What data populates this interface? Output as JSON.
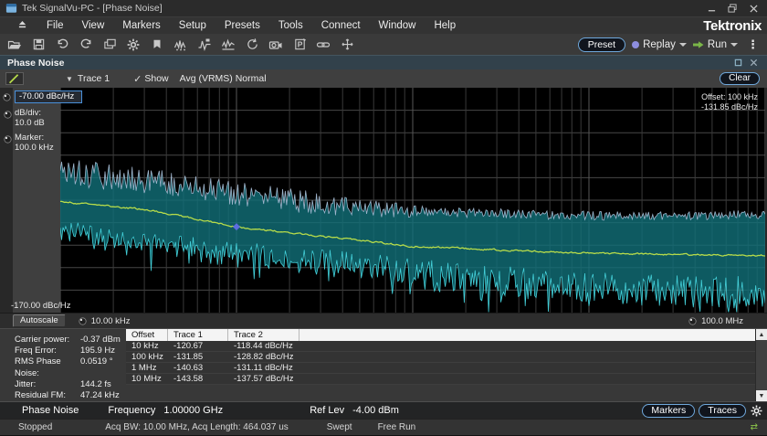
{
  "window": {
    "title": "Tek SignalVu-PC - [Phase Noise]",
    "brand": "Tektronix"
  },
  "menu": {
    "items": [
      "File",
      "View",
      "Markers",
      "Setup",
      "Presets",
      "Tools",
      "Connect",
      "Window",
      "Help"
    ]
  },
  "toolbar": {
    "preset": "Preset",
    "replay": "Replay",
    "run": "Run",
    "icons": [
      "open",
      "save",
      "undo",
      "redo",
      "displays",
      "settings",
      "marker-banner",
      "spurious",
      "pulse-marker",
      "spectrum",
      "loop",
      "camera",
      "paste-p",
      "link",
      "expand"
    ]
  },
  "panel": {
    "title": "Phase Noise",
    "clear": "Clear"
  },
  "trace_bar": {
    "trace": "Trace 1",
    "show": "Show",
    "mode": "Avg (VRMS) Normal"
  },
  "sidebar": {
    "top_ref": "-70.00 dBc/Hz",
    "db_div_label": "dB/div:",
    "db_div_value": "10.0 dB",
    "marker_label": "Marker:",
    "marker_value": "100.0 kHz",
    "bottom_ref": "-170.00 dBc/Hz",
    "autoscale": "Autoscale"
  },
  "xaxis": {
    "start": "10.00 kHz",
    "stop": "100.0 MHz"
  },
  "measurements": {
    "rows": [
      {
        "label": "Carrier power:",
        "value": "-0.37 dBm"
      },
      {
        "label": "Freq Error:",
        "value": "195.9 Hz"
      },
      {
        "label": "RMS Phase Noise:",
        "value": "0.0519 °"
      },
      {
        "label": "Jitter:",
        "value": "144.2 fs"
      },
      {
        "label": "Residual FM:",
        "value": "47.24 kHz"
      }
    ]
  },
  "results_table": {
    "headers": [
      "Offset",
      "Trace 1",
      "Trace 2"
    ],
    "rows": [
      {
        "offset": "10 kHz",
        "trace1": "-120.67 dBc/Hz",
        "trace2": "-118.44 dBc/Hz"
      },
      {
        "offset": "100 kHz",
        "trace1": "-131.85 dBc/Hz",
        "trace2": "-128.82 dBc/Hz"
      },
      {
        "offset": "1 MHz",
        "trace1": "-140.63 dBc/Hz",
        "trace2": "-131.11 dBc/Hz"
      },
      {
        "offset": "10 MHz",
        "trace1": "-143.58 dBc/Hz",
        "trace2": "-137.57 dBc/Hz"
      }
    ]
  },
  "settings_bar": {
    "measurement": "Phase Noise",
    "frequency_label": "Frequency",
    "frequency_value": "1.00000 GHz",
    "ref_label": "Ref Lev",
    "ref_value": "-4.00 dBm",
    "markers": "Markers",
    "traces": "Traces"
  },
  "status_bar": {
    "state": "Stopped",
    "acq": "Acq BW: 10.00 MHz, Acq Length: 464.037 us",
    "sweep": "Swept",
    "trigger": "Free Run"
  },
  "colors": {
    "trace1": "#b6db4a",
    "trace2_edge_upper": "#b9cce8",
    "trace2_edge_lower": "#4ae2ec",
    "trace2_fill": "#117079",
    "marker": "#5b6ce0",
    "accent_border": "#6fa8dc",
    "run_green": "#7ab648",
    "replay_purple": "#8d8dde"
  },
  "chart_data": {
    "type": "line",
    "title": "Phase Noise",
    "x_axis": {
      "scale": "log",
      "min_hz": 10000,
      "max_hz": 100000000,
      "start_label": "10.00 kHz",
      "stop_label": "100.0 MHz",
      "decades": 4
    },
    "y_axis": {
      "unit": "dBc/Hz",
      "max": -70,
      "min": -170,
      "db_per_div": 10,
      "top_label": "-70.00 dBc/Hz",
      "bottom_label": "-170.00 dBc/Hz",
      "divisions": 10
    },
    "annotation": [
      "Offset: 100 kHz",
      "-131.85 dBc/Hz"
    ],
    "marker": {
      "offset_hz": 100000,
      "value_db": -131.85
    },
    "key_points": {
      "Trace 1": [
        [
          10000,
          -120.67
        ],
        [
          100000,
          -131.85
        ],
        [
          1000000,
          -140.63
        ],
        [
          10000000,
          -143.58
        ]
      ],
      "Trace 2": [
        [
          10000,
          -118.44
        ],
        [
          100000,
          -128.82
        ],
        [
          1000000,
          -131.11
        ],
        [
          10000000,
          -137.57
        ]
      ]
    },
    "series": [
      {
        "name": "Trace 1",
        "style": "avg_line",
        "color": "#b6db4a",
        "jitter_db": 1.5,
        "anchors_logf_db": [
          [
            4,
            -120.7
          ],
          [
            4.5,
            -124.5
          ],
          [
            5,
            -131.9
          ],
          [
            5.5,
            -136.3
          ],
          [
            6,
            -140.6
          ],
          [
            6.5,
            -142.2
          ],
          [
            7,
            -143.6
          ],
          [
            7.5,
            -144.2
          ],
          [
            8,
            -144.6
          ]
        ]
      },
      {
        "name": "Trace 2",
        "style": "minmax_band",
        "color": "#4ae2ec",
        "fill": "#117079",
        "upper_anchors_logf_db": [
          [
            4,
            -107
          ],
          [
            4.3,
            -110
          ],
          [
            4.7,
            -113
          ],
          [
            5,
            -117
          ],
          [
            5.3,
            -120
          ],
          [
            5.7,
            -123
          ],
          [
            6,
            -125
          ],
          [
            6.5,
            -126
          ],
          [
            7,
            -127
          ],
          [
            8,
            -126.5
          ]
        ],
        "lower_anchors_logf_db": [
          [
            4,
            -128
          ],
          [
            4.3,
            -133
          ],
          [
            4.7,
            -136
          ],
          [
            5,
            -138
          ],
          [
            5.3,
            -141
          ],
          [
            5.7,
            -143
          ],
          [
            6,
            -146
          ],
          [
            6.5,
            -149
          ],
          [
            7,
            -152
          ],
          [
            8,
            -154
          ]
        ],
        "upper_noise_db": [
          [
            4,
            6
          ],
          [
            5.6,
            5
          ],
          [
            6.1,
            2.2
          ],
          [
            8,
            2
          ]
        ],
        "lower_noise_db": [
          [
            4,
            8
          ],
          [
            5.6,
            10
          ],
          [
            6.1,
            14
          ],
          [
            8,
            15
          ]
        ]
      }
    ],
    "grid": true,
    "noise_seed": 11
  }
}
